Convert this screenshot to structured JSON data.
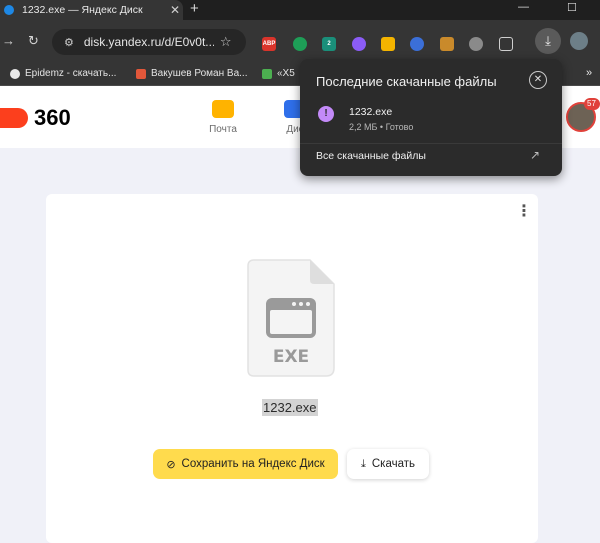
{
  "browser": {
    "tab_title": "1232.exe — Яндекс Диск",
    "tab_close": "✕",
    "new_tab": "+",
    "address": "disk.yandex.ru/d/E0v0t...",
    "extensions": [
      "ABP",
      "2"
    ],
    "bookmarks": [
      "Epidemz - скачать...",
      "Вакушев Роман Ва...",
      "«X5"
    ],
    "bookmarks_overflow": "»"
  },
  "header": {
    "logo_text": "360",
    "services": [
      "Почта",
      "Дис"
    ],
    "notification_count": "57"
  },
  "file": {
    "type_label": "EXE",
    "name": "1232.exe",
    "save_button": "Сохранить на Яндекс Диск",
    "download_button": "Скачать"
  },
  "downloads_popup": {
    "title": "Последние скачанные файлы",
    "item_name": "1232.exe",
    "item_meta": "2,2 МБ • Готово",
    "all_link": "Все скачанные файлы"
  },
  "colors": {
    "accent_yellow": "#ffdb4d",
    "yandex_red": "#fc3f1d",
    "download_purple": "#c38af8"
  }
}
